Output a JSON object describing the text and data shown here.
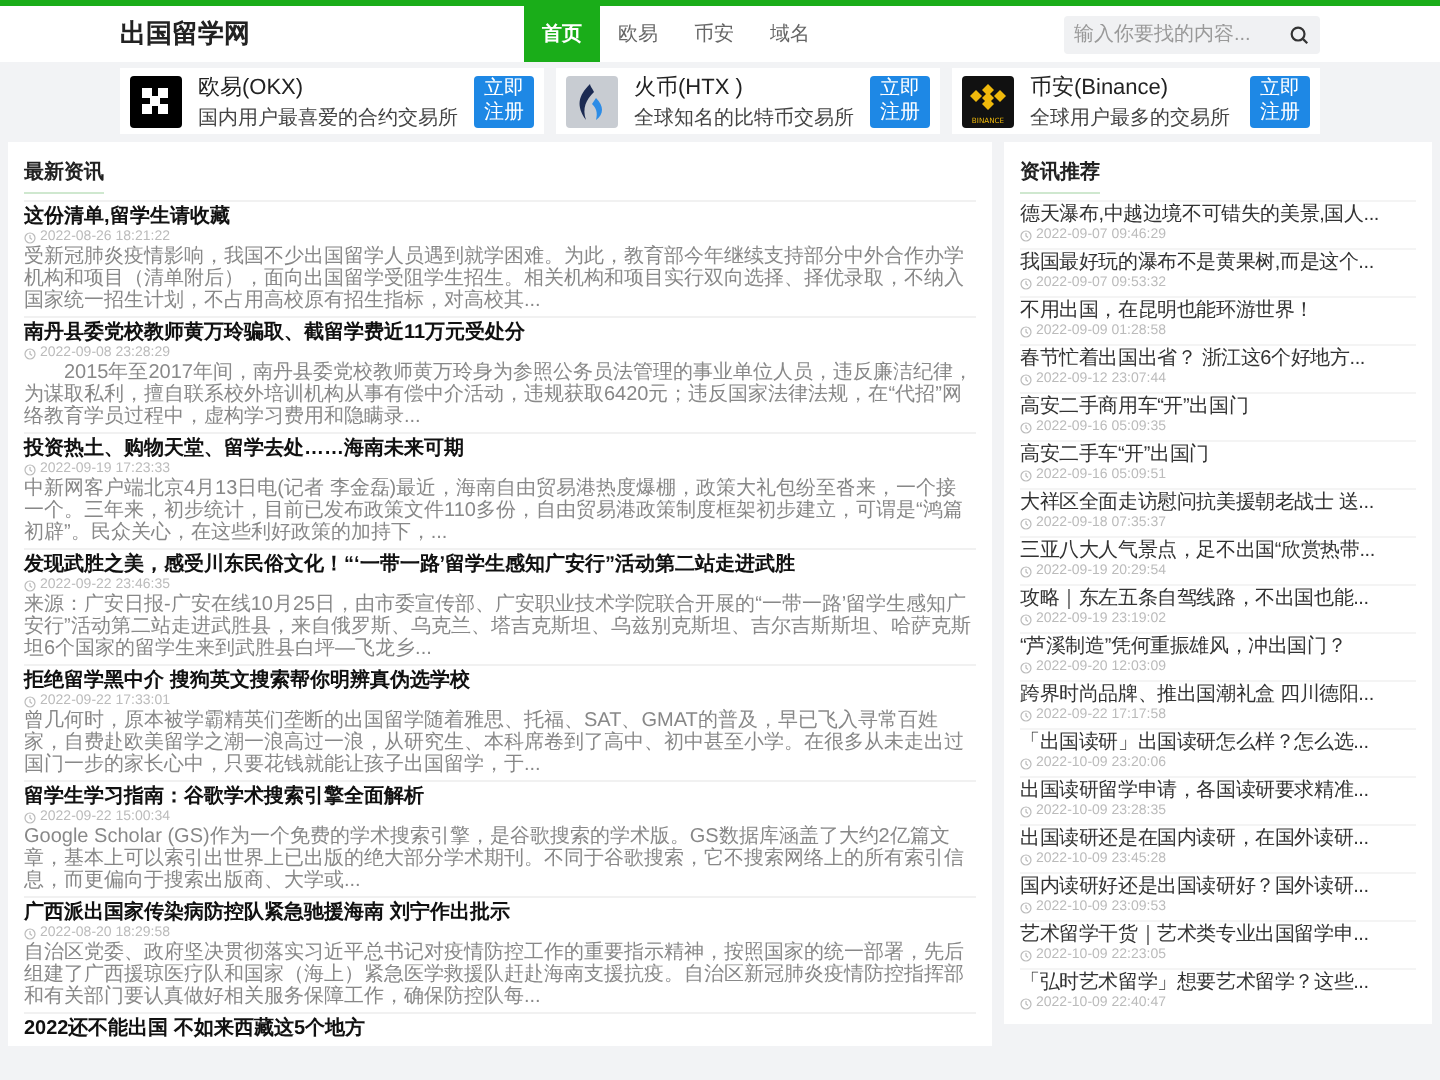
{
  "site": {
    "logo": "出国留学网"
  },
  "nav": [
    {
      "label": "首页",
      "selected": true
    },
    {
      "label": "欧易",
      "selected": false
    },
    {
      "label": "币安",
      "selected": false
    },
    {
      "label": "域名",
      "selected": false
    }
  ],
  "search": {
    "placeholder": "输入你要找的内容..."
  },
  "exchanges": [
    {
      "kind": "okx",
      "name": "欧易(OKX)",
      "description": "国内用户最喜爱的合约交易所",
      "button": "立即注册"
    },
    {
      "kind": "htx",
      "name": "火币(HTX )",
      "description": "全球知名的比特币交易所",
      "button": "立即注册"
    },
    {
      "kind": "binance",
      "name": "币安(Binance)",
      "description": "全球用户最多的交易所",
      "button": "立即注册",
      "logo_text": "BINANCE"
    }
  ],
  "latest": {
    "title": "最新资讯",
    "articles": [
      {
        "title": "这份清单,留学生请收藏",
        "date": "2022-08-26 18:21:22",
        "excerpt": "受新冠肺炎疫情影响，我国不少出国留学人员遇到就学困难。为此，教育部今年继续支持部分中外合作办学机构和项目（清单附后），面向出国留学受阻学生招生。相关机构和项目实行双向选择、择优录取，不纳入国家统一招生计划，不占用高校原有招生指标，对高校其..."
      },
      {
        "title": "南丹县委党校教师黄万玲骗取、截留学费近11万元受处分",
        "date": "2022-09-08 23:28:29",
        "excerpt": "　　2015年至2017年间，南丹县委党校教师黄万玲身为参照公务员法管理的事业单位人员，违反廉洁纪律，为谋取私利，擅自联系校外培训机构从事有偿中介活动，违规获取6420元；违反国家法律法规，在“代招”网络教育学员过程中，虚构学习费用和隐瞒录..."
      },
      {
        "title": "投资热土、购物天堂、留学去处……海南未来可期",
        "date": "2022-09-19 17:23:33",
        "excerpt": "中新网客户端北京4月13日电(记者 李金磊)最近，海南自由贸易港热度爆棚，政策大礼包纷至沓来，一个接一个。三年来，初步统计，目前已发布政策文件110多份，自由贸易港政策制度框架初步建立，可谓是“鸿篇初辟”。民众关心，在这些利好政策的加持下，..."
      },
      {
        "title": "发现武胜之美，感受川东民俗文化！“‘一带一路’留学生感知广安行”活动第二站走进武胜",
        "date": "2022-09-22 23:46:35",
        "excerpt": "来源：广安日报-广安在线10月25日，由市委宣传部、广安职业技术学院联合开展的“一带一路’留学生感知广安行”活动第二站走进武胜县，来自俄罗斯、乌克兰、塔吉克斯坦、乌兹别克斯坦、吉尔吉斯斯坦、哈萨克斯坦6个国家的留学生来到武胜县白坪—飞龙乡..."
      },
      {
        "title": "拒绝留学黑中介 搜狗英文搜索帮你明辨真伪选学校",
        "date": "2022-09-22 17:33:01",
        "excerpt": "曾几何时，原本被学霸精英们垄断的出国留学随着雅思、托福、SAT、GMAT的普及，早已飞入寻常百姓家，自费赴欧美留学之潮一浪高过一浪，从研究生、本科席卷到了高中、初中甚至小学。在很多从未走出过国门一步的家长心中，只要花钱就能让孩子出国留学，于..."
      },
      {
        "title": "留学生学习指南：谷歌学术搜索引擎全面解析",
        "date": "2022-09-22 15:00:34",
        "excerpt": "Google Scholar (GS)作为一个免费的学术搜索引擎，是谷歌搜索的学术版。GS数据库涵盖了大约2亿篇文章，基本上可以索引出世界上已出版的绝大部分学术期刊。不同于谷歌搜索，它不搜索网络上的所有索引信息，而更偏向于搜索出版商、大学或..."
      },
      {
        "title": "广西派出国家传染病防控队紧急驰援海南 刘宁作出批示",
        "date": "2022-08-20 18:29:58",
        "excerpt": "自治区党委、政府坚决贯彻落实习近平总书记对疫情防控工作的重要指示精神，按照国家的统一部署，先后组建了广西援琼医疗队和国家（海上）紧急医学救援队赶赴海南支援抗疫。自治区新冠肺炎疫情防控指挥部和有关部门要认真做好相关服务保障工作，确保防控队每..."
      },
      {
        "title": "2022还不能出国 不如来西藏这5个地方"
      }
    ]
  },
  "recommended": {
    "title": "资讯推荐",
    "items": [
      {
        "title": "德天瀑布,中越边境不可错失的美景,国人...",
        "date": "2022-09-07 09:46:29"
      },
      {
        "title": "我国最好玩的瀑布不是黄果树,而是这个...",
        "date": "2022-09-07 09:53:32"
      },
      {
        "title": "不用出国，在昆明也能环游世界！",
        "date": "2022-09-09 01:28:58"
      },
      {
        "title": "春节忙着出国出省？ 浙江这6个好地方...",
        "date": "2022-09-12 23:07:44"
      },
      {
        "title": "高安二手商用车“开”出国门",
        "date": "2022-09-16 05:09:35"
      },
      {
        "title": "高安二手车“开”出国门",
        "date": "2022-09-16 05:09:51"
      },
      {
        "title": "大祥区全面走访慰问抗美援朝老战士 送...",
        "date": "2022-09-18 07:35:37"
      },
      {
        "title": "三亚八大人气景点，足不出国“欣赏热带...",
        "date": "2022-09-19 20:29:54"
      },
      {
        "title": "攻略｜东左五条自驾线路，不出国也能...",
        "date": "2022-09-19 23:19:02"
      },
      {
        "title": "“芦溪制造”凭何重振雄风，冲出国门？",
        "date": "2022-09-20 12:03:09"
      },
      {
        "title": "跨界时尚品牌、推出国潮礼盒 四川德阳...",
        "date": "2022-09-22 17:17:58"
      },
      {
        "title": "「出国读研」出国读研怎么样？怎么选...",
        "date": "2022-10-09 23:20:06"
      },
      {
        "title": "出国读研留学申请，各国读研要求精准...",
        "date": "2022-10-09 23:28:35"
      },
      {
        "title": "出国读研还是在国内读研，在国外读研...",
        "date": "2022-10-09 23:45:28"
      },
      {
        "title": "国内读研好还是出国读研好？国外读研...",
        "date": "2022-10-09 23:09:53"
      },
      {
        "title": "艺术留学干货｜艺术类专业出国留学申...",
        "date": "2022-10-09 22:23:05"
      },
      {
        "title": "「弘时艺术留学」想要艺术留学？这些...",
        "date": "2022-10-09 22:40:47"
      }
    ]
  }
}
